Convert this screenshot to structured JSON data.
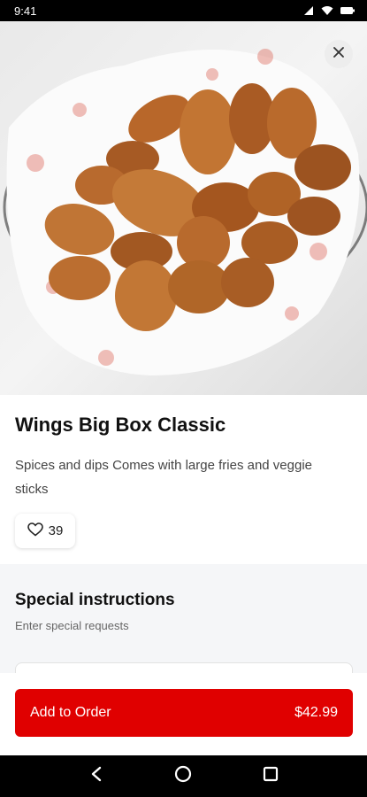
{
  "status_bar": {
    "time": "9:41"
  },
  "item": {
    "title": "Wings Big Box Classic",
    "description": "Spices and dips Comes with large fries and veggie sticks",
    "likes": "39"
  },
  "special_instructions": {
    "title": "Special instructions",
    "subtitle": "Enter special requests"
  },
  "order_button": {
    "label": "Add to Order",
    "price": "$42.99"
  },
  "colors": {
    "accent": "#e00000",
    "section_bg": "#f5f6f8"
  },
  "icons": [
    "signal-icon",
    "wifi-icon",
    "battery-icon",
    "close-icon",
    "heart-icon",
    "back-icon",
    "home-icon",
    "recents-icon"
  ]
}
